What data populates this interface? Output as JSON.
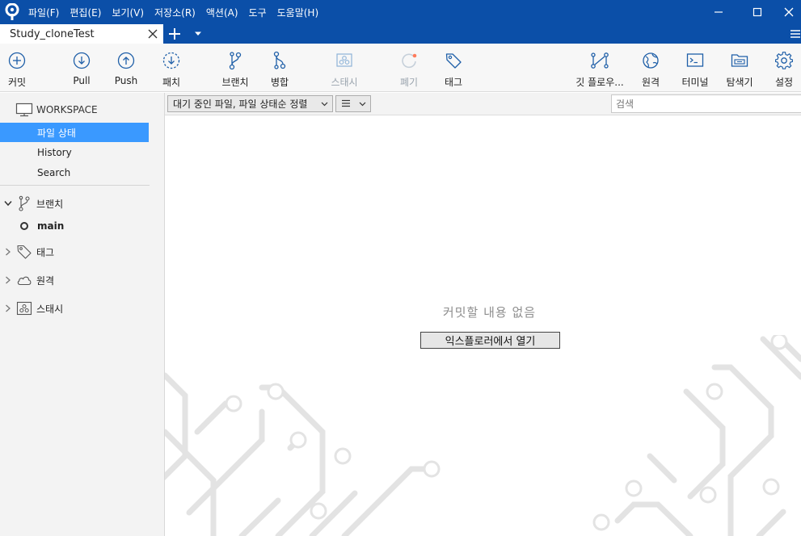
{
  "menu": [
    "파일(F)",
    "편집(E)",
    "보기(V)",
    "저장소(R)",
    "액션(A)",
    "도구",
    "도움말(H)"
  ],
  "tab": {
    "title": "Study_cloneTest"
  },
  "toolbar": {
    "commit": "커밋",
    "pull": "Pull",
    "push": "Push",
    "fetch": "패치",
    "branch": "브랜치",
    "merge": "병합",
    "stash": "스태시",
    "discard": "폐기",
    "tag": "태그",
    "gitflow": "깃 플로우...",
    "remote": "원격",
    "terminal": "터미널",
    "explorer": "탐색기",
    "settings": "설정"
  },
  "sidebar": {
    "workspace": "WORKSPACE",
    "workspace_items": [
      "파일 상태",
      "History",
      "Search"
    ],
    "branches": "브랜치",
    "branch_items": [
      "main"
    ],
    "tags": "태그",
    "remotes": "원격",
    "stashes": "스태시"
  },
  "main": {
    "filter": "대기 중인 파일, 파일 상태순 정렬",
    "search_placeholder": "검색",
    "empty_message": "커밋할 내용 없음",
    "open_explorer": "익스플로러에서 열기"
  },
  "colors": {
    "titlebar": "#0b4fa8",
    "accent": "#3a99ff",
    "icon": "#1f5fa8",
    "discard_dot": "#ff7b5c"
  }
}
